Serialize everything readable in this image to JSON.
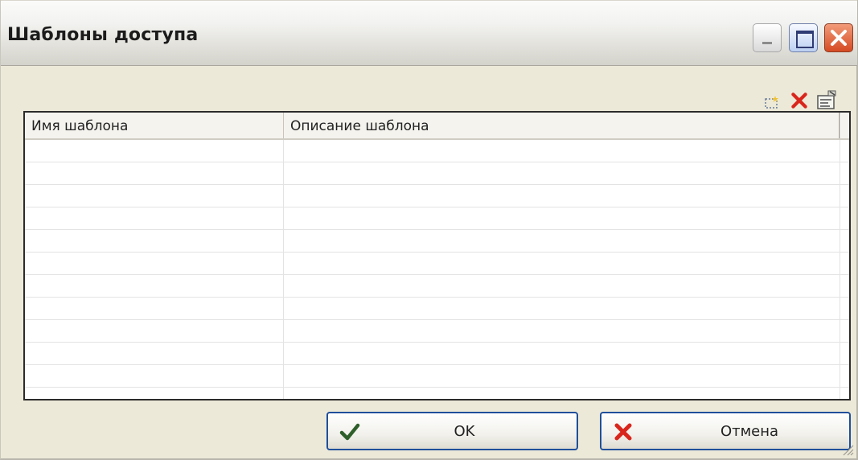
{
  "window": {
    "title": "Шаблоны доступа",
    "controls": [
      "minimize-icon",
      "maximize-icon",
      "close-icon"
    ]
  },
  "toolbar": {
    "icons": [
      "new-item-icon",
      "delete-icon",
      "properties-icon"
    ]
  },
  "table": {
    "columns": [
      "Имя шаблона",
      "Описание шаблона"
    ],
    "rows": [
      [
        "",
        ""
      ],
      [
        "",
        ""
      ],
      [
        "",
        ""
      ],
      [
        "",
        ""
      ],
      [
        "",
        ""
      ],
      [
        "",
        ""
      ],
      [
        "",
        ""
      ],
      [
        "",
        ""
      ],
      [
        "",
        ""
      ],
      [
        "",
        ""
      ],
      [
        "",
        ""
      ],
      [
        "",
        ""
      ]
    ]
  },
  "buttons": {
    "ok_label": "OK",
    "cancel_label": "Отмена"
  },
  "colors": {
    "dialog_background": "#ece9d8",
    "button_border": "#1f4f9a",
    "close_button": "#d54a23",
    "delete_icon": "#d9261c",
    "ok_check": "#2e5f2a"
  }
}
